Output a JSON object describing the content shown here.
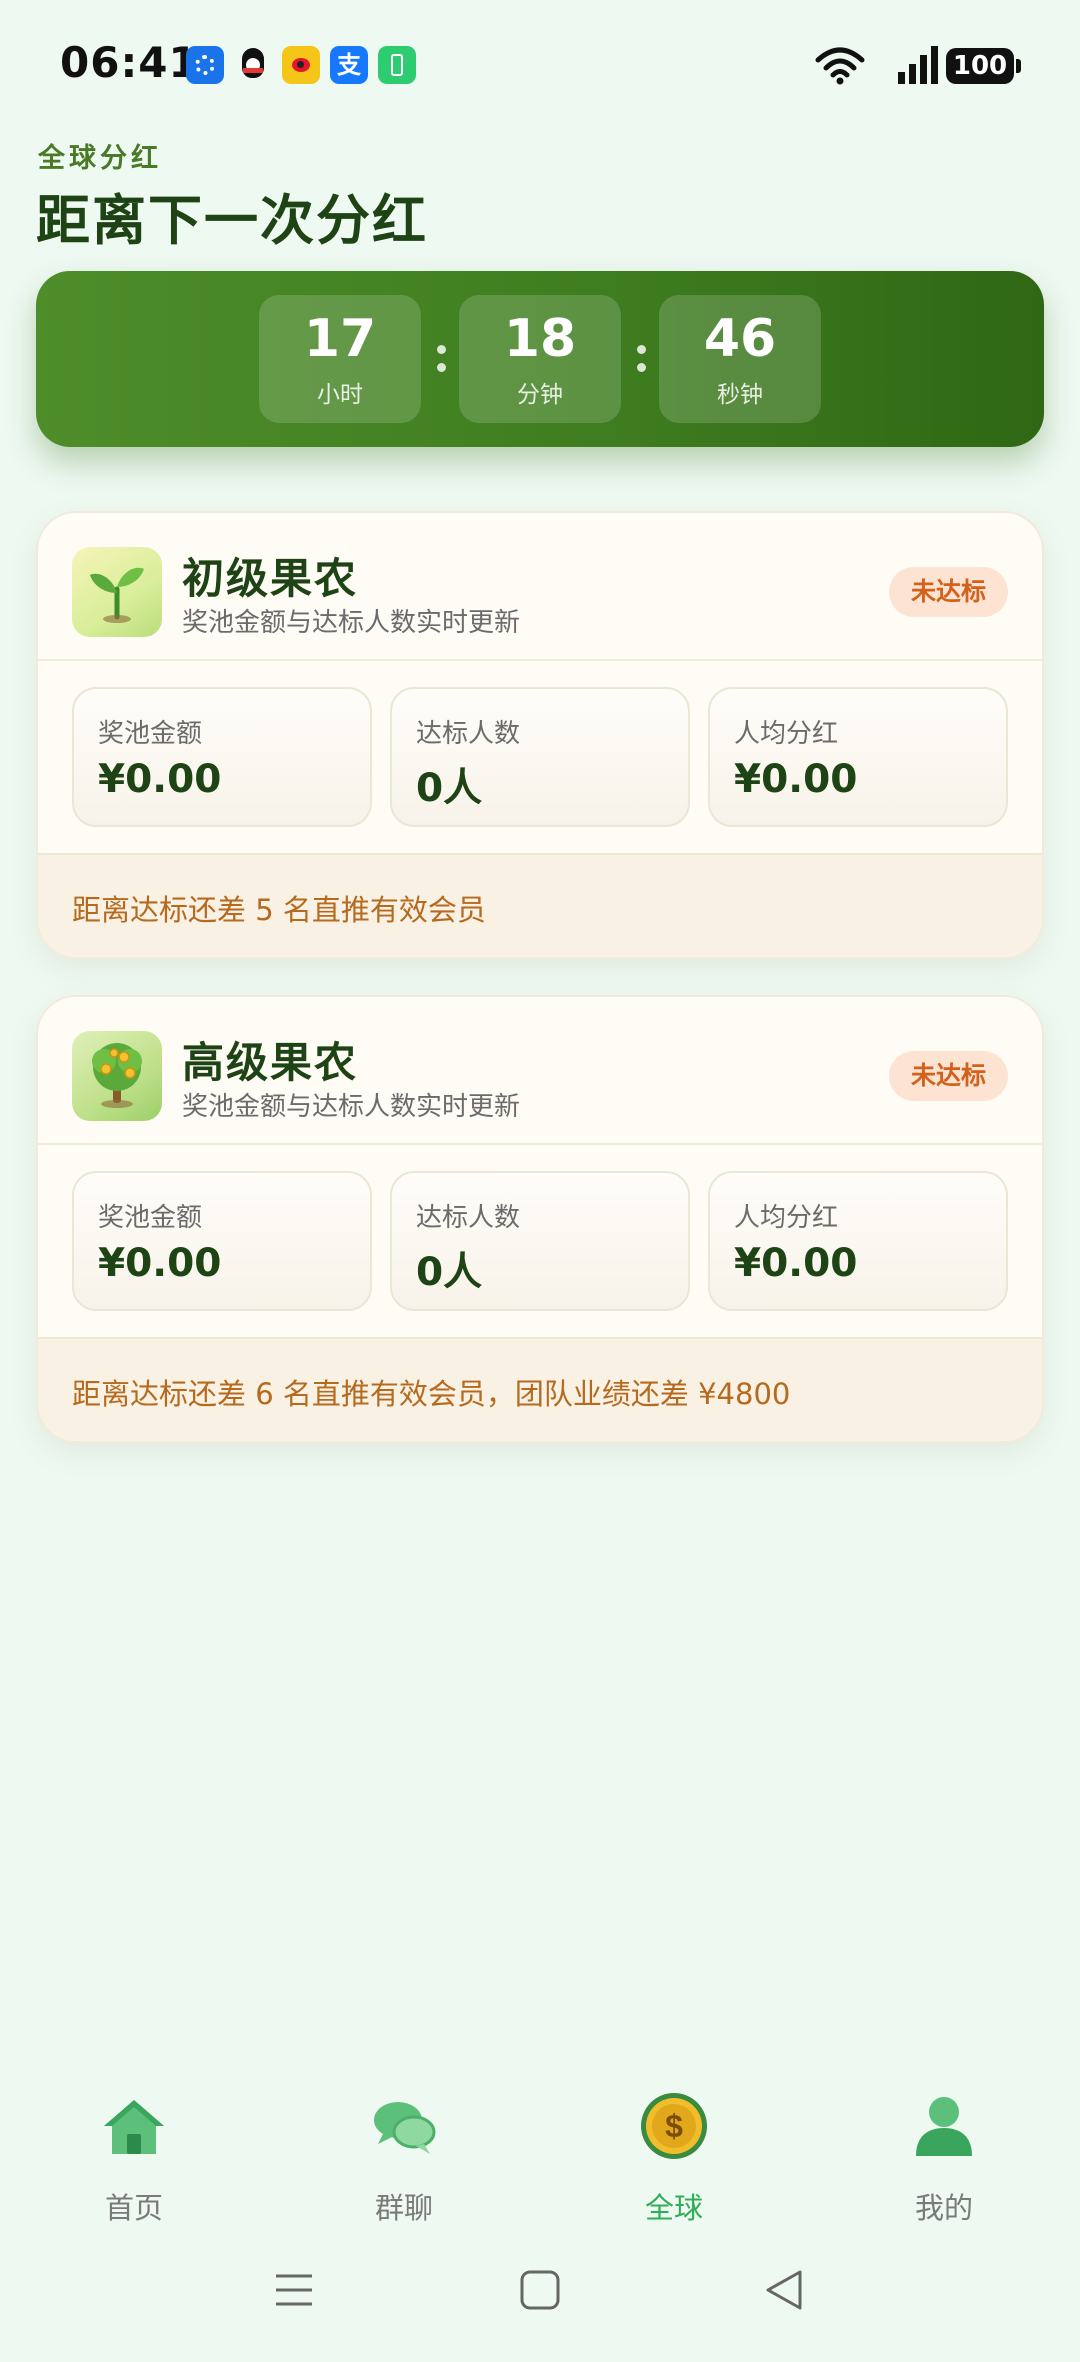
{
  "status_bar": {
    "time": "06:41",
    "battery": "100",
    "notification_icons": [
      "fan-app-icon",
      "qq-icon",
      "weibo-icon",
      "alipay-icon",
      "battery-app-icon"
    ]
  },
  "header": {
    "subtitle": "全球分红",
    "title": "距离下一次分红"
  },
  "countdown": {
    "hours": "17",
    "hours_unit": "小时",
    "minutes": "18",
    "minutes_unit": "分钟",
    "seconds": "46",
    "seconds_unit": "秒钟"
  },
  "tiers": [
    {
      "name": "初级果农",
      "desc": "奖池金额与达标人数实时更新",
      "badge": "未达标",
      "icon": "sprout-icon",
      "stats": [
        {
          "label": "奖池金额",
          "value": "¥0.00"
        },
        {
          "label": "达标人数",
          "value": "0人"
        },
        {
          "label": "人均分红",
          "value": "¥0.00"
        }
      ],
      "note": "距离达标还差 5 名直推有效会员"
    },
    {
      "name": "高级果农",
      "desc": "奖池金额与达标人数实时更新",
      "badge": "未达标",
      "icon": "money-tree-icon",
      "stats": [
        {
          "label": "奖池金额",
          "value": "¥0.00"
        },
        {
          "label": "达标人数",
          "value": "0人"
        },
        {
          "label": "人均分红",
          "value": "¥0.00"
        }
      ],
      "note": "距离达标还差 6 名直推有效会员，团队业绩还差 ¥4800"
    }
  ],
  "bottom_nav": {
    "items": [
      {
        "label": "首页",
        "icon": "home-icon"
      },
      {
        "label": "群聊",
        "icon": "chat-icon"
      },
      {
        "label": "全球",
        "icon": "coin-icon",
        "active": true
      },
      {
        "label": "我的",
        "icon": "profile-icon"
      }
    ]
  },
  "colors": {
    "accent_green": "#2fae57",
    "countdown_bg": "#3f7e20",
    "badge_text": "#d2611c",
    "note_text": "#b66a1e"
  }
}
